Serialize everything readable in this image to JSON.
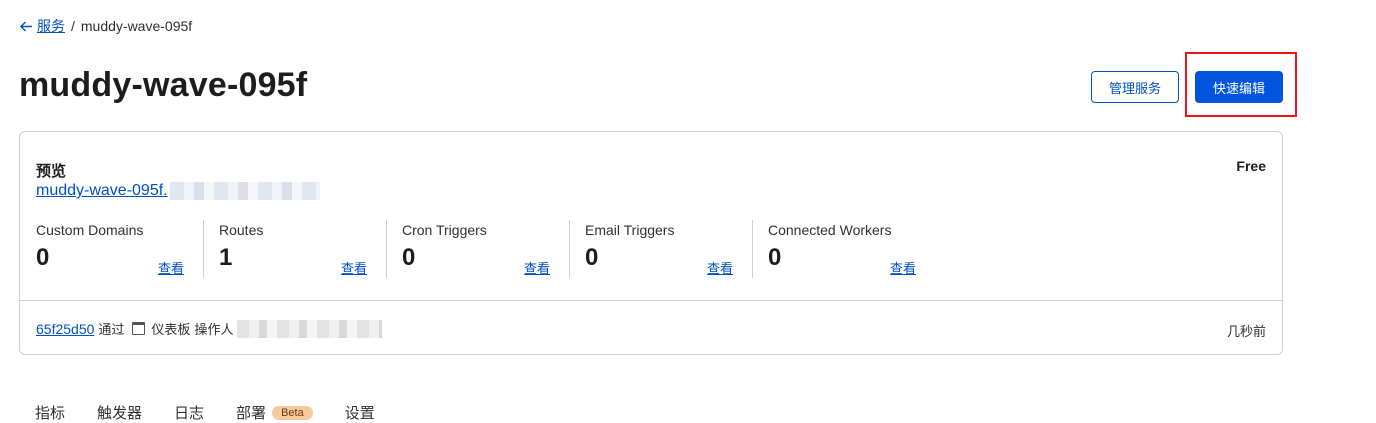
{
  "breadcrumb": {
    "back_label": "服务",
    "separator": "/",
    "current": "muddy-wave-095f"
  },
  "page": {
    "title": "muddy-wave-095f"
  },
  "actions": {
    "manage_label": "管理服务",
    "quick_edit_label": "快速编辑"
  },
  "card": {
    "preview_label": "预览",
    "plan": "Free",
    "preview_link": "muddy-wave-095f.",
    "metrics": [
      {
        "label": "Custom Domains",
        "value": "0",
        "view": "查看"
      },
      {
        "label": "Routes",
        "value": "1",
        "view": "查看"
      },
      {
        "label": "Cron Triggers",
        "value": "0",
        "view": "查看"
      },
      {
        "label": "Email Triggers",
        "value": "0",
        "view": "查看"
      },
      {
        "label": "Connected Workers",
        "value": "0",
        "view": "查看"
      }
    ],
    "deployment": {
      "hash": "65f25d50",
      "via": "通过",
      "source": "仪表板",
      "operator_label": "操作人",
      "time": "几秒前"
    }
  },
  "tabs": [
    {
      "label": "指标"
    },
    {
      "label": "触发器"
    },
    {
      "label": "日志"
    },
    {
      "label": "部署",
      "badge": "Beta"
    },
    {
      "label": "设置"
    }
  ],
  "colors": {
    "accent": "#0055dc",
    "link": "#0051c3",
    "highlight": "#e8161b",
    "beta_badge": "#f9c99e"
  },
  "icons": {
    "back": "arrow-left-icon",
    "source": "calendar-icon"
  }
}
